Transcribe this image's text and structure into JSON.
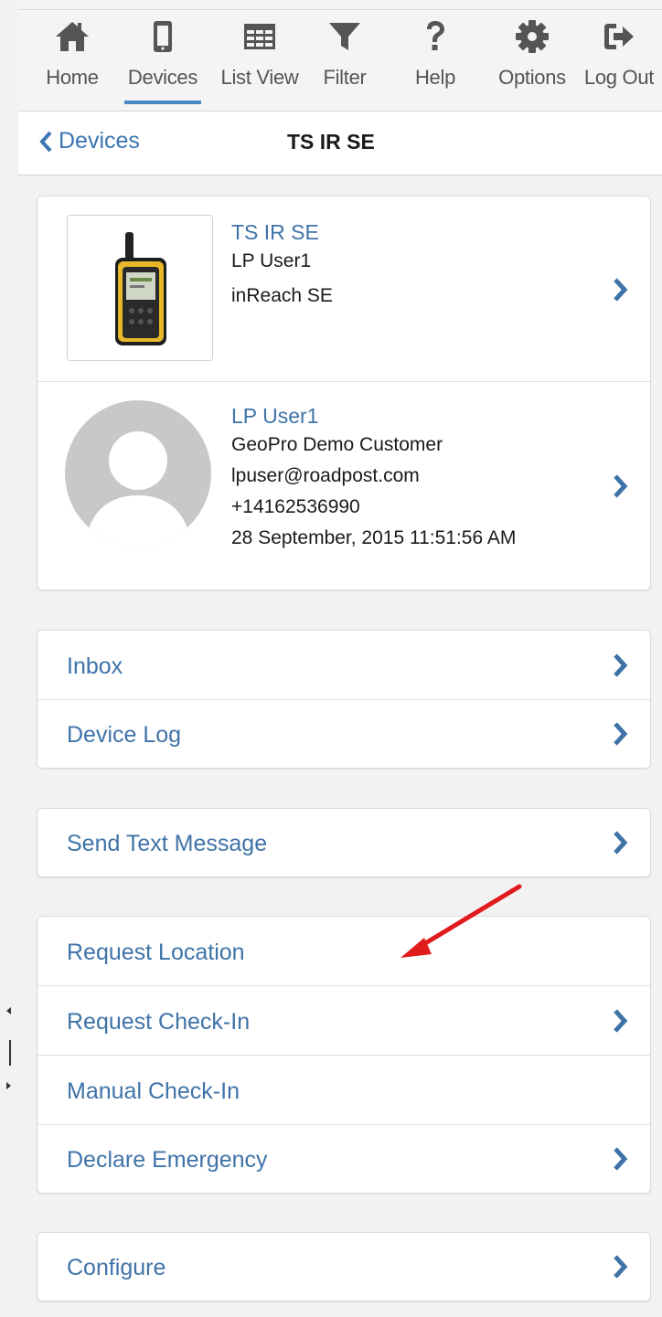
{
  "nav": {
    "items": [
      {
        "label": "Home",
        "icon": "home-icon"
      },
      {
        "label": "Devices",
        "icon": "mobile-icon",
        "active": true
      },
      {
        "label": "List View",
        "icon": "table-icon"
      },
      {
        "label": "Filter",
        "icon": "filter-icon"
      },
      {
        "label": "Help",
        "icon": "question-icon"
      },
      {
        "label": "Options",
        "icon": "gear-icon"
      },
      {
        "label": "Log Out",
        "icon": "logout-icon"
      }
    ]
  },
  "subheader": {
    "back_label": "Devices",
    "title": "TS IR SE"
  },
  "device_card": {
    "device": {
      "name": "TS IR SE",
      "user": "LP User1",
      "model": "inReach SE"
    },
    "user": {
      "name": "LP User1",
      "company": "GeoPro Demo Customer",
      "email": "lpuser@roadpost.com",
      "phone": "+14162536990",
      "timestamp": "28 September, 2015 11:51:56 AM"
    }
  },
  "menu_groups": [
    [
      {
        "label": "Inbox",
        "chevron": true
      },
      {
        "label": "Device Log",
        "chevron": true
      }
    ],
    [
      {
        "label": "Send Text Message",
        "chevron": true
      }
    ],
    [
      {
        "label": "Request Location",
        "chevron": false
      },
      {
        "label": "Request Check-In",
        "chevron": true
      },
      {
        "label": "Manual Check-In",
        "chevron": false
      },
      {
        "label": "Declare Emergency",
        "chevron": true
      }
    ],
    [
      {
        "label": "Configure",
        "chevron": true
      }
    ]
  ],
  "colors": {
    "accent": "#3f73a8",
    "nav_icon": "#555555",
    "annotation_arrow": "#e01b1b",
    "avatar": "#c8c8c8"
  }
}
